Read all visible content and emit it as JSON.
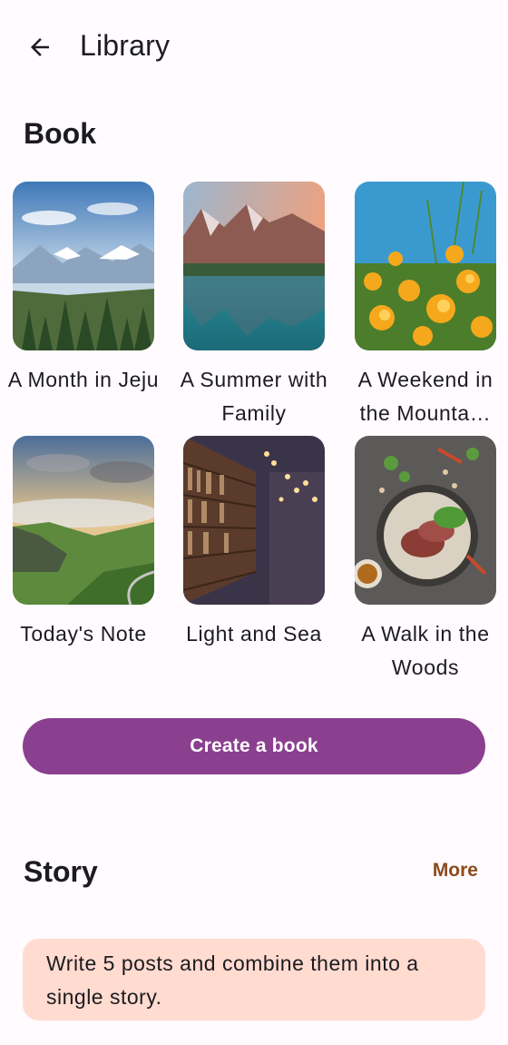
{
  "app_bar": {
    "title": "Library",
    "back_icon": "arrow-left-icon"
  },
  "book_section": {
    "title": "Book",
    "books": [
      {
        "label": "A Month in Jeju",
        "cover": "mountain-lake-forest"
      },
      {
        "label": "A Summer with Family",
        "cover": "mountain-lake-reflection"
      },
      {
        "label": "A Weekend in the Mounta…",
        "cover": "yellow-flowers"
      },
      {
        "label": "Today's Note",
        "cover": "green-hills-clouds"
      },
      {
        "label": "Light and Sea",
        "cover": "library-bookshelves"
      },
      {
        "label": "A Walk in the Woods",
        "cover": "food-plate"
      }
    ],
    "create_button": "Create a book"
  },
  "story_section": {
    "title": "Story",
    "more_link": "More",
    "card_text": "Write 5 posts and combine them into a single story."
  },
  "colors": {
    "primary": "#8b3f8f",
    "more_link": "#8b4a1e",
    "story_card_bg": "#ffdbd0",
    "background": "#fffbfe"
  }
}
